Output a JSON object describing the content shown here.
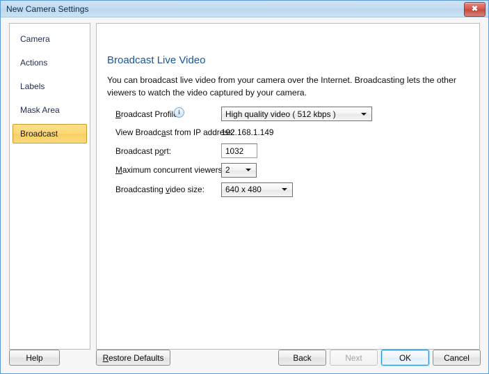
{
  "window": {
    "title": "New Camera Settings",
    "close_label": "✖",
    "close_icon": "close-icon"
  },
  "sidebar": {
    "items": [
      {
        "label": "Camera",
        "selected": false
      },
      {
        "label": "Actions",
        "selected": false
      },
      {
        "label": "Labels",
        "selected": false
      },
      {
        "label": "Mask Area",
        "selected": false
      },
      {
        "label": "Broadcast",
        "selected": true
      }
    ]
  },
  "content": {
    "heading": "Broadcast Live Video",
    "description": "You can broadcast live video from your camera over the Internet. Broadcasting lets the other viewers to watch the video captured by your camera."
  },
  "form": {
    "broadcast_profile": {
      "label_prefix": "",
      "label_accel": "B",
      "label_suffix": "roadcast Profile:",
      "info_icon": "info-icon",
      "value": "High quality video ( 512 kbps )"
    },
    "ip_address": {
      "label_prefix": "View Broadc",
      "label_accel": "a",
      "label_suffix": "st from IP address:",
      "value": "192.168.1.149"
    },
    "broadcast_port": {
      "label_prefix": "Broadcast p",
      "label_accel": "o",
      "label_suffix": "rt:",
      "value": "1032"
    },
    "max_viewers": {
      "label_prefix": "",
      "label_accel": "M",
      "label_suffix": "aximum concurrent viewers:",
      "value": "2"
    },
    "video_size": {
      "label_prefix": "Broadcasting ",
      "label_accel": "v",
      "label_suffix": "ideo size:",
      "value": "640 x 480"
    }
  },
  "footer": {
    "help": {
      "label": "Help",
      "accel": "",
      "prefix": "Help",
      "suffix": ""
    },
    "restore": {
      "prefix": "",
      "accel": "R",
      "suffix": "estore Defaults"
    },
    "back": {
      "prefix": "Back",
      "accel": "",
      "suffix": ""
    },
    "next": {
      "prefix": "Next",
      "accel": "",
      "suffix": "",
      "disabled": true
    },
    "ok": {
      "prefix": "OK",
      "accel": "",
      "suffix": "",
      "default": true
    },
    "cancel": {
      "prefix": "Cancel",
      "accel": "",
      "suffix": ""
    }
  },
  "colors": {
    "accent_blue": "#18569f",
    "selected_gold": "#fbd87a",
    "selected_border": "#c99b2e",
    "close_red": "#c44a3e",
    "focus_blue": "#2f93d1"
  }
}
